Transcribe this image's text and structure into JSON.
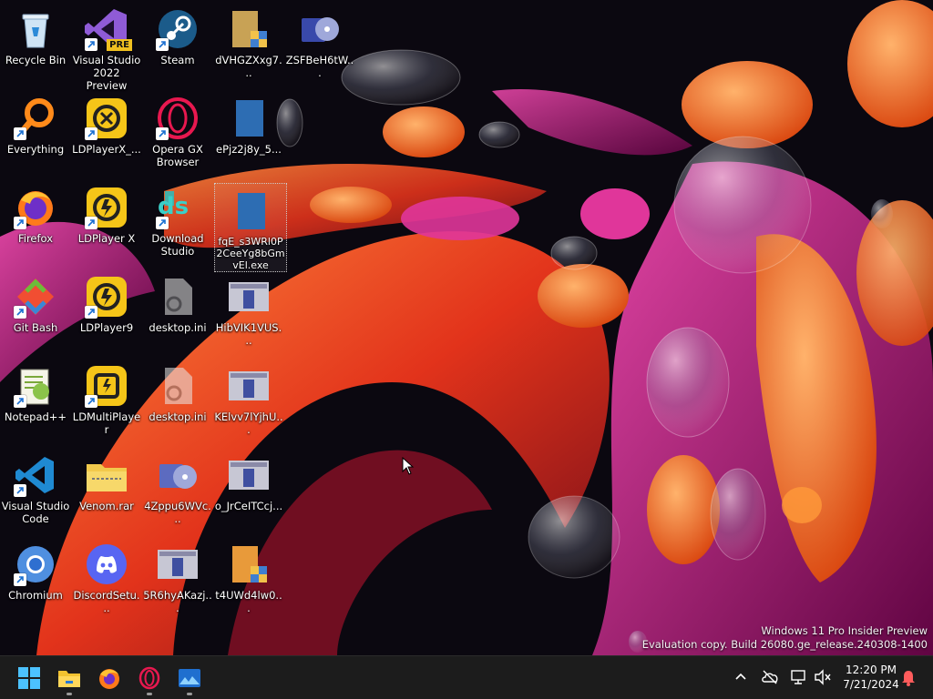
{
  "desktop": {
    "icons": [
      {
        "label": "Recycle Bin"
      },
      {
        "label": "Visual Studio 2022 Preview",
        "badge": "PRE"
      },
      {
        "label": "Steam"
      },
      {
        "label": "dVHGZXxg7..."
      },
      {
        "label": "ZSFBeH6tW..."
      },
      {
        "label": "Everything"
      },
      {
        "label": "LDPlayerX_..."
      },
      {
        "label": "Opera GX Browser"
      },
      {
        "label": "ePjz2j8y_5..."
      },
      {
        "label": "Firefox"
      },
      {
        "label": "LDPlayer X"
      },
      {
        "label": "Download Studio",
        "glyph_text": "ds"
      },
      {
        "label": "fqE_s3WRl0P2CeeYg8bGmvEl.exe"
      },
      {
        "label": "Git Bash"
      },
      {
        "label": "LDPlayer9"
      },
      {
        "label": "desktop.ini"
      },
      {
        "label": "HibVIK1VUS..."
      },
      {
        "label": "Notepad++"
      },
      {
        "label": "LDMultiPlayer"
      },
      {
        "label": "desktop.ini"
      },
      {
        "label": "KElvv7lYjhU..."
      },
      {
        "label": "Visual Studio Code"
      },
      {
        "label": "Venom.rar"
      },
      {
        "label": "4Zppu6WVc..."
      },
      {
        "label": "o_JrCeITCcj..."
      },
      {
        "label": "Chromium"
      },
      {
        "label": "DiscordSetu..."
      },
      {
        "label": "5R6hyAKazj..."
      },
      {
        "label": "t4UWd4lw0..."
      }
    ]
  },
  "watermark": {
    "line1": "Windows 11 Pro Insider Preview",
    "line2": "Evaluation copy. Build 26080.ge_release.240308-1400"
  },
  "taskbar": {
    "items": [
      {
        "icon": "windows-start-icon"
      },
      {
        "icon": "file-explorer-icon"
      },
      {
        "icon": "firefox-icon"
      },
      {
        "icon": "opera-gx-icon"
      },
      {
        "icon": "image-app-icon"
      }
    ],
    "tray": [
      {
        "icon": "chevron-up-icon"
      },
      {
        "icon": "cloud-off-icon"
      },
      {
        "icon": "network-icon"
      },
      {
        "icon": "volume-muted-icon"
      }
    ],
    "clock": {
      "time": "12:20 PM",
      "date": "7/21/2024"
    },
    "notification_icon": "bell-icon"
  },
  "colors": {
    "accent_orange": "#ff6a1a",
    "accent_magenta": "#d0157a",
    "taskbar_bg": "#1c1c1c",
    "bell": "#ff5c5c"
  }
}
